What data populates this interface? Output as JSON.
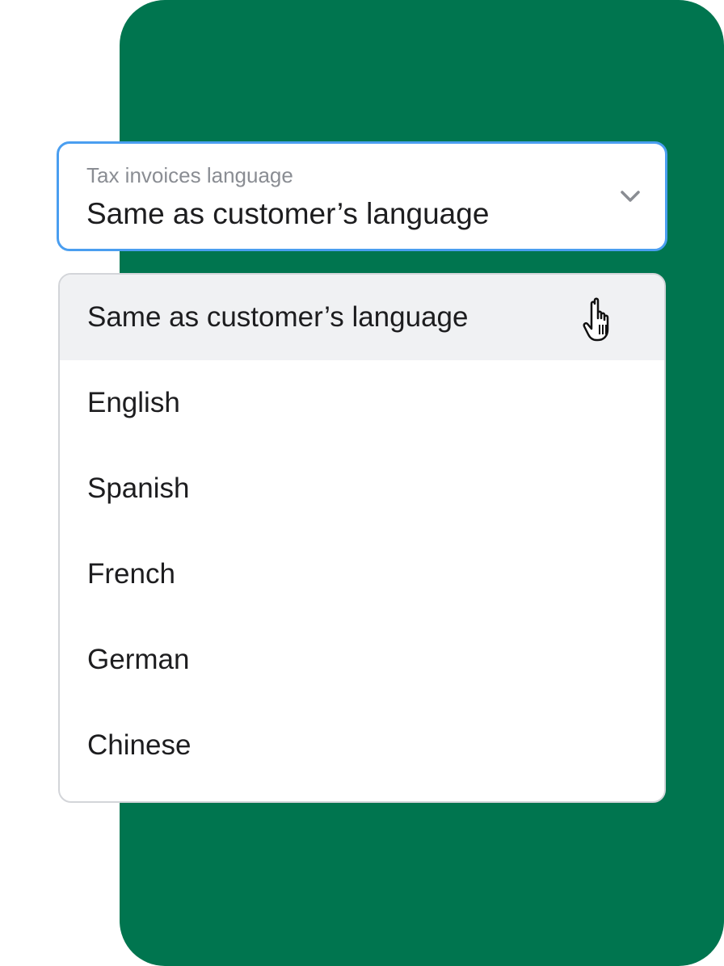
{
  "colors": {
    "panel_background": "#00754f",
    "focus_border": "#4a9ef0",
    "highlight_row": "#f0f1f3"
  },
  "select": {
    "label": "Tax invoices language",
    "value": "Same as customer’s language",
    "icon": "chevron-down-icon"
  },
  "dropdown": {
    "options": [
      {
        "label": "Same as customer’s language",
        "highlighted": true
      },
      {
        "label": "English"
      },
      {
        "label": "Spanish"
      },
      {
        "label": "French"
      },
      {
        "label": "German"
      },
      {
        "label": "Chinese"
      }
    ]
  },
  "cursor": {
    "icon": "pointer-hand-icon"
  }
}
